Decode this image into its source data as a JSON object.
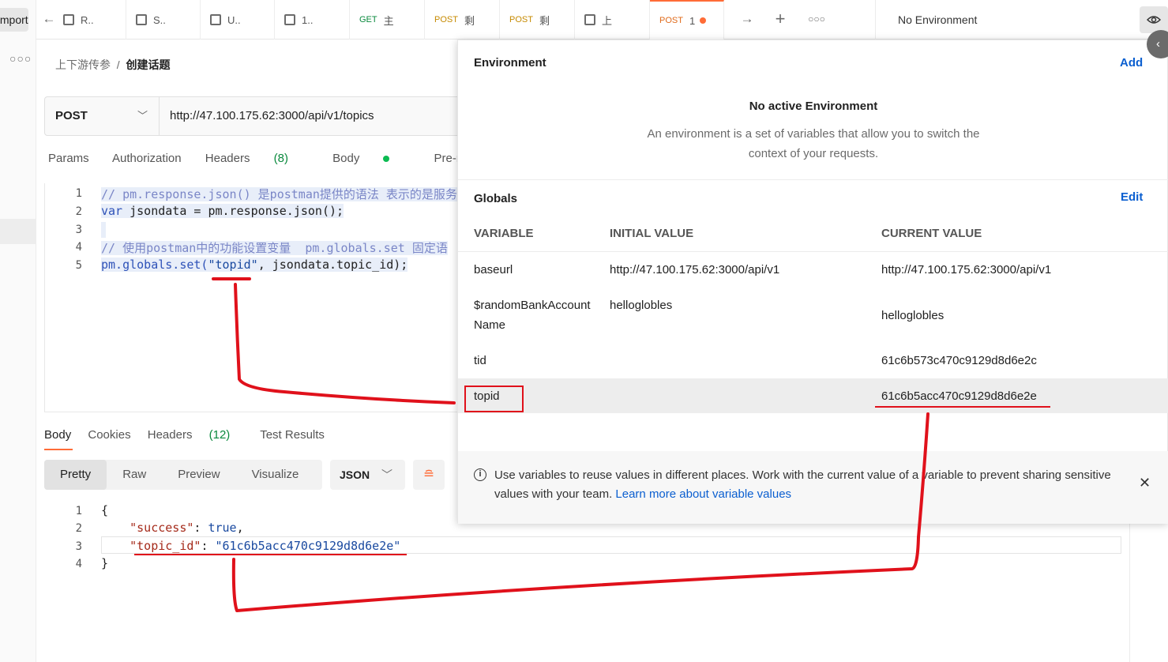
{
  "rail": {
    "import_label": "Import"
  },
  "tabs": [
    {
      "method": "",
      "label": "R.."
    },
    {
      "method": "",
      "label": "S.."
    },
    {
      "method": "",
      "label": "U.."
    },
    {
      "method": "",
      "label": "1.."
    },
    {
      "method": "GET",
      "label": "主"
    },
    {
      "method": "POST",
      "label": "剩"
    },
    {
      "method": "POST",
      "label": "剩"
    },
    {
      "method": "",
      "label": "上"
    },
    {
      "method": "POST",
      "label": "1"
    }
  ],
  "environment_selector": "No Environment",
  "breadcrumb": {
    "parent": "上下游传参",
    "current": "创建话题"
  },
  "request": {
    "method": "POST",
    "url": "http://47.100.175.62:3000/api/v1/topics",
    "tabs": {
      "params": "Params",
      "authorization": "Authorization",
      "headers": "Headers",
      "headers_count": "(8)",
      "body": "Body",
      "prerequest": "Pre-request Sc"
    }
  },
  "script_lines": [
    {
      "n": "1",
      "text": "// pm.response.json() 是postman提供的语法 表示的是服务"
    },
    {
      "n": "2",
      "kw": "var",
      "rest": " jsondata = pm.response.json();"
    },
    {
      "n": "3",
      "text": ""
    },
    {
      "n": "4",
      "text": "// 使用postman中的功能设置变量  pm.globals.set 固定语"
    },
    {
      "n": "5",
      "pre": "pm.globals.set(",
      "str": "\"topid\"",
      "post": ", jsondata.topic_id);"
    }
  ],
  "response": {
    "tabs": {
      "body": "Body",
      "cookies": "Cookies",
      "headers": "Headers",
      "headers_count": "(12)",
      "tests": "Test Results"
    },
    "views": [
      "Pretty",
      "Raw",
      "Preview",
      "Visualize"
    ],
    "format": "JSON",
    "lines": [
      {
        "n": "1",
        "text": "{"
      },
      {
        "n": "2",
        "key": "\"success\"",
        "val": "true",
        "tail": ","
      },
      {
        "n": "3",
        "key": "\"topic_id\"",
        "val": "\"61c6b5acc470c9129d8d6e2e\"",
        "tail": ""
      },
      {
        "n": "4",
        "text": "}"
      }
    ]
  },
  "env_panel": {
    "title": "Environment",
    "add": "Add",
    "no_active_title": "No active Environment",
    "no_active_desc_1": "An environment is a set of variables that allow you to switch the",
    "no_active_desc_2": "context of your requests.",
    "globals_title": "Globals",
    "edit": "Edit",
    "columns": [
      "VARIABLE",
      "INITIAL VALUE",
      "CURRENT VALUE"
    ],
    "rows": [
      {
        "variable": "baseurl",
        "initial": "http://47.100.175.62:3000/api/v1",
        "current": "http://47.100.175.62:3000/api/v1"
      },
      {
        "variable": "$randomBankAccount",
        "variable_2": "Name",
        "initial": "helloglobles",
        "current": "helloglobles"
      },
      {
        "variable": "tid",
        "initial": "",
        "current": "61c6b573c470c9129d8d6e2c"
      },
      {
        "variable": "topid",
        "initial": "",
        "current": "61c6b5acc470c9129d8d6e2e"
      }
    ],
    "info_text": "Use variables to reuse values in different places. Work with the current value of a variable to prevent sharing sensitive values with your team.",
    "info_link": "Learn more about variable values"
  },
  "colors": {
    "accent": "#ff6c37",
    "link": "#0b5fd0",
    "annotation": "#e0111b"
  }
}
